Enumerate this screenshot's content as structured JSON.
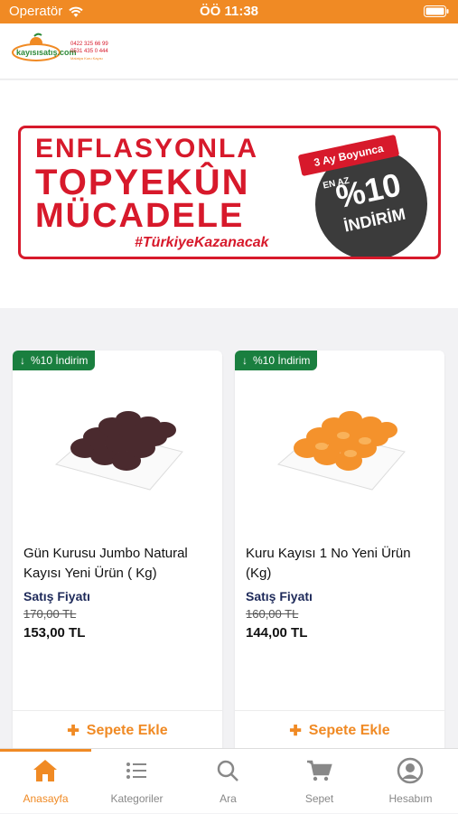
{
  "status": {
    "carrier": "Operatör",
    "time": "ÖÖ 11:38"
  },
  "header": {
    "logo_text": "kayısısatış.com",
    "phone1": "0422 325 66 99",
    "phone2": "0531 435 0 444",
    "tagline": "Malatya Kuru Kayısı"
  },
  "banner": {
    "line1": "ENFLASYONLA",
    "line2": "TOPYEKÛN",
    "line3": "MÜCADELE",
    "hashtag": "#TürkiyeKazanacak",
    "ribbon": "3 Ay Boyunca",
    "en_az": "EN AZ",
    "percent": "%10",
    "indirim": "İNDİRİM"
  },
  "products": [
    {
      "discount": "%10 İndirim",
      "name": "Gün Kurusu Jumbo Natural Kayısı Yeni Ürün ( Kg)",
      "price_label": "Satış Fiyatı",
      "old_price": "170,00 TL",
      "new_price": "153,00 TL",
      "add_label": "Sepete Ekle"
    },
    {
      "discount": "%10 İndirim",
      "name": "Kuru Kayısı 1 No Yeni Ürün (Kg)",
      "price_label": "Satış Fiyatı",
      "old_price": "160,00 TL",
      "new_price": "144,00 TL",
      "add_label": "Sepete Ekle"
    }
  ],
  "tabs": [
    {
      "label": "Anasayfa",
      "icon": "home-icon"
    },
    {
      "label": "Kategoriler",
      "icon": "list-icon"
    },
    {
      "label": "Ara",
      "icon": "search-icon"
    },
    {
      "label": "Sepet",
      "icon": "cart-icon"
    },
    {
      "label": "Hesabım",
      "icon": "account-icon"
    }
  ],
  "colors": {
    "accent": "#f08a24",
    "brand_red": "#d7192b",
    "discount_green": "#1a7f3f",
    "price_navy": "#1e2a5a"
  }
}
